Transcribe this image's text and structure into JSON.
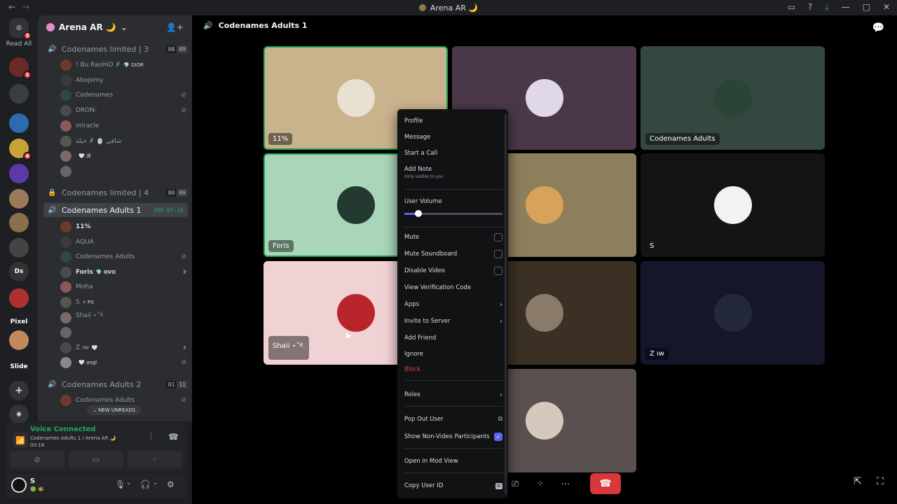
{
  "window": {
    "title": "Arena AR 🌙"
  },
  "rail": {
    "read_all": "Read All",
    "home_badge": "3",
    "servers": [
      {
        "label": "",
        "color": "#6b2a2a",
        "badge": "1"
      },
      {
        "label": "",
        "color": "#3b3d44"
      },
      {
        "label": "",
        "color": "#2b6cb0"
      },
      {
        "label": "",
        "color": "#c7a236",
        "badge": "4"
      },
      {
        "label": "",
        "color": "#5b3aa8"
      },
      {
        "label": "",
        "color": "#9b7a5a"
      },
      {
        "label": "",
        "color": "#8b6f4a"
      },
      {
        "label": "",
        "color": "#444"
      },
      {
        "label": "Ds",
        "color": "#333"
      },
      {
        "label": "",
        "color": "#b03030"
      },
      {
        "label": "Pixel",
        "color": "#1e1f22"
      },
      {
        "label": "",
        "color": "#c28a5a"
      },
      {
        "label": "Slide",
        "color": "#1e1f22"
      }
    ]
  },
  "guild": {
    "name": "Arena AR 🌙"
  },
  "channels": [
    {
      "name": "Codenames limited | 3",
      "count_a": "08",
      "count_b": "09"
    },
    {
      "name": "Codenames limited | 4",
      "count_a": "00",
      "count_b": "09"
    },
    {
      "name": "Codenames Adults 1",
      "timer": "298:07:16"
    },
    {
      "name": "Codenames Adults 2",
      "count_a": "01",
      "count_b": "11"
    }
  ],
  "users_ch1": [
    {
      "name": "! Bu RasHiD ✗",
      "tag": "💎 DIOR"
    },
    {
      "name": "Abojemy"
    },
    {
      "name": "Codenames"
    },
    {
      "name": "DRON-"
    },
    {
      "name": "miracle"
    },
    {
      "name": "شافي 🍵 ✗ خيلة"
    },
    {
      "name": "",
      "tag": "🤍 𝓡"
    },
    {
      "name": ""
    }
  ],
  "users_ch3": [
    {
      "name": "11%"
    },
    {
      "name": "AQUA"
    },
    {
      "name": "Codenames Adults"
    },
    {
      "name": "Foris",
      "tag": "💎 OVO"
    },
    {
      "name": "Moha"
    },
    {
      "name": "S",
      "tag": "⚡ PX"
    },
    {
      "name": "Shaii ⋆˚࿔."
    },
    {
      "name": ""
    },
    {
      "name": "Z ıw",
      "tag": "🤍"
    },
    {
      "name": "",
      "tag": "🤍 angl"
    }
  ],
  "users_ch4": [
    {
      "name": "Codenames Adults"
    }
  ],
  "new_unreads": "NEW UNREADS",
  "voice": {
    "status": "Voice Connected",
    "channel": "Codenames Adults 1 / Arena AR 🌙",
    "elapsed": "00:18"
  },
  "user": {
    "name": "S"
  },
  "main": {
    "channel_title": "Codenames Adults 1"
  },
  "tiles": [
    {
      "label": "11%",
      "bg": "#c9b38c",
      "av": "#e8e0d0"
    },
    {
      "label": "",
      "bg": "#4a3848",
      "av": "#e0d8e8"
    },
    {
      "label": "Codenames Adults",
      "bg": "#354840",
      "av": "#2b4438"
    },
    {
      "label": "Foris",
      "bg": "#a9d5b8",
      "av": "#243a30"
    },
    {
      "label": "",
      "bg": "#8d7e5c",
      "av": "#d8a25a"
    },
    {
      "label": "S",
      "bg": "#141414",
      "av": "#f2f2f2"
    },
    {
      "label": "Shaii ⋆˚࿔.",
      "bg": "#f0d2d4",
      "av": "#b8242c"
    },
    {
      "label": "",
      "bg": "#3a3024",
      "av": "#8a7a6a"
    },
    {
      "label": "Z ıw",
      "bg": "#15162a",
      "av": "#23293a"
    },
    {
      "label": "",
      "bg": "#5a5050",
      "av": "#d6c8bc"
    }
  ],
  "menu": {
    "profile": "Profile",
    "message": "Message",
    "start_call": "Start a Call",
    "add_note": "Add Note",
    "add_note_sub": "Only visible to you",
    "user_volume": "User Volume",
    "volume_level": 0.14,
    "mute": "Mute",
    "mute_soundboard": "Mute Soundboard",
    "disable_video": "Disable Video",
    "view_verification": "View Verification Code",
    "apps": "Apps",
    "invite": "Invite to Server",
    "add_friend": "Add Friend",
    "ignore": "Ignore",
    "block": "Block",
    "roles": "Roles",
    "pop_out": "Pop Out User",
    "show_nonvideo": "Show Non-Video Participants",
    "show_nonvideo_checked": true,
    "mod_view": "Open in Mod View",
    "copy_id": "Copy User ID",
    "id_badge": "ID"
  }
}
